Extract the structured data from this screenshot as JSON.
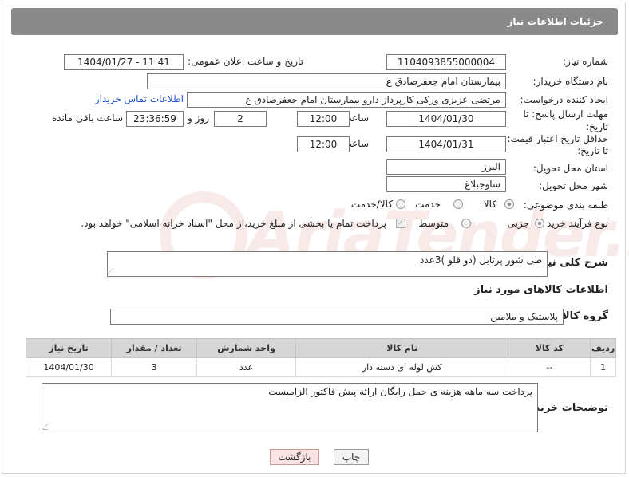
{
  "header": {
    "title": "جزئیات اطلاعات نیاز"
  },
  "need_number": {
    "label": "شماره نیاز:",
    "value": "1104093855000004"
  },
  "announce": {
    "label": "تاریخ و ساعت اعلان عمومی:",
    "value": "1404/01/27 - 11:41"
  },
  "buyer_org": {
    "label": "نام دستگاه خریدار:",
    "value": "بیمارستان امام جعفرصادق ع"
  },
  "requester": {
    "label": "ایجاد کننده درخواست:",
    "value": "مرتضی عزیزی ورکی کارپرداز دارو بیمارستان امام جعفرصادق ع",
    "contact_link": "اطلاعات تماس خریدار"
  },
  "reply_deadline": {
    "label_line1": "مهلت ارسال پاسخ: تا",
    "label_line2": "تاریخ:",
    "date": "1404/01/30",
    "time_label": "ساعت",
    "time": "12:00",
    "days_value": "2",
    "days_label": "روز و",
    "remaining_time": "23:36:59",
    "remaining_label": "ساعت باقی مانده"
  },
  "price_validity": {
    "label_line1": "حداقل تاریخ اعتبار قیمت:",
    "label_line2": "تا تاریخ:",
    "date": "1404/01/31",
    "time_label": "ساعت",
    "time": "12:00"
  },
  "province": {
    "label": "استان محل تحویل:",
    "value": "البرز"
  },
  "city": {
    "label": "شهر محل تحویل:",
    "value": "ساوجبلاغ"
  },
  "category": {
    "label": "طبقه بندی موضوعی:",
    "options": [
      "کالا",
      "خدمت",
      "کالا/خدمت"
    ],
    "selected": "کالا"
  },
  "purchase_type": {
    "label": "نوع فرآیند خرید :",
    "options": [
      "جزیی",
      "متوسط"
    ],
    "selected": "جزیی",
    "payment_note": "پرداخت تمام یا بخشی از مبلغ خرید،از محل \"اسناد خزانه اسلامی\" خواهد بود."
  },
  "description": {
    "label": "شرح کلی نیاز:",
    "value": "طی شور پرتابل (دو قلو )3عدد"
  },
  "goods_section": {
    "title": "اطلاعات کالاهای مورد نیاز"
  },
  "goods_group": {
    "label": "گروه کالا:",
    "value": "پلاستیک و ملامین"
  },
  "table": {
    "headers": [
      "ردیف",
      "کد کالا",
      "نام کالا",
      "واحد شمارش",
      "تعداد / مقدار",
      "تاریخ نیاز"
    ],
    "rows": [
      [
        "1",
        "--",
        "کش لوله ای دسته دار",
        "عدد",
        "3",
        "1404/01/30"
      ]
    ]
  },
  "buyer_notes": {
    "label": "توضیحات خریدار:",
    "value": "پرداخت سه ماهه هزینه ی حمل رایگان ارائه پیش فاکتور الزامیست"
  },
  "buttons": {
    "print": "چاپ",
    "back": "بازگشت"
  },
  "watermark": {
    "text": "AriaTender.neT"
  },
  "colors": {
    "header_bg": "#8a8a8a",
    "link": "#1a4fd0",
    "back_button_bg": "#fbe3e3"
  }
}
